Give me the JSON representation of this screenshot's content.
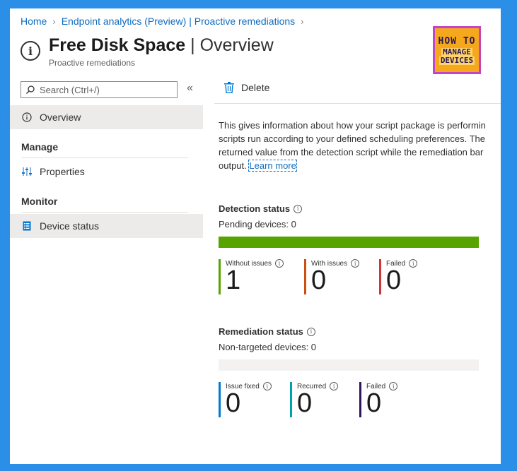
{
  "breadcrumb": [
    "Home",
    "Endpoint analytics (Preview) | Proactive remediations"
  ],
  "header": {
    "title_bold": "Free Disk Space",
    "title_sep": " | ",
    "title_light": "Overview",
    "subtitle": "Proactive remediations"
  },
  "logo": {
    "line1": "HOW TO",
    "line2": "MANAGE",
    "line3": "DEVICES"
  },
  "search": {
    "placeholder": "Search (Ctrl+/)"
  },
  "sidebar": {
    "collapse_glyph": "«",
    "overview": "Overview",
    "manage_section": "Manage",
    "properties": "Properties",
    "monitor_section": "Monitor",
    "device_status": "Device status"
  },
  "toolbar": {
    "delete_label": "Delete"
  },
  "description": {
    "line1": "This gives information about how your script package is performin",
    "line2": "scripts run according to your defined scheduling preferences. The",
    "line3": "returned value from the detection script while the remediation bar",
    "line4_prefix": "output. ",
    "learn_more": "Learn more"
  },
  "detection": {
    "title": "Detection status",
    "sub": "Pending devices: 0",
    "bar_color": "#57a300",
    "stats": [
      {
        "label": "Without issues",
        "value": "1",
        "color": "#57a300"
      },
      {
        "label": "With issues",
        "value": "0",
        "color": "#ca5010"
      },
      {
        "label": "Failed",
        "value": "0",
        "color": "#d13438"
      }
    ]
  },
  "remediation": {
    "title": "Remediation status",
    "sub": "Non-targeted devices: 0",
    "bar_color": "#f3f2f1",
    "stats": [
      {
        "label": "Issue fixed",
        "value": "0",
        "color": "#0078d4"
      },
      {
        "label": "Recurred",
        "value": "0",
        "color": "#00a2ad"
      },
      {
        "label": "Failed",
        "value": "0",
        "color": "#32145a"
      }
    ]
  }
}
